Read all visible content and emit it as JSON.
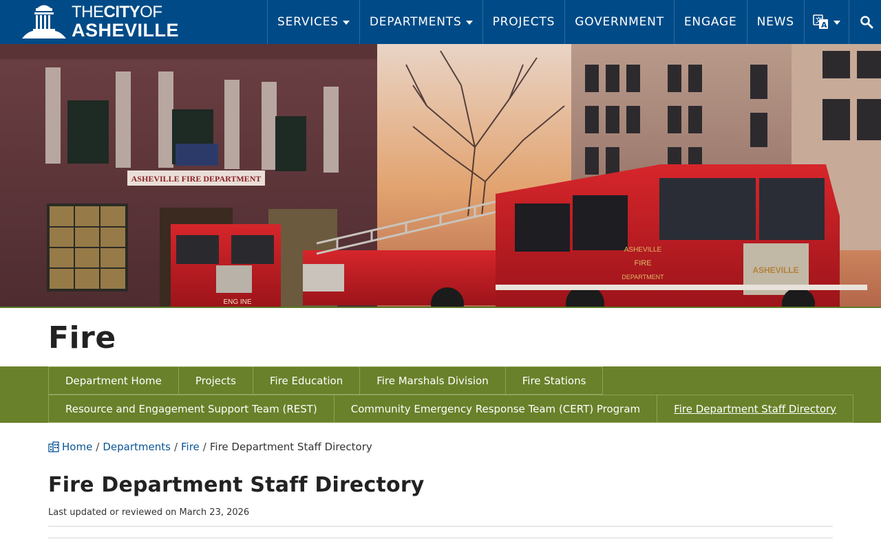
{
  "header": {
    "logo": {
      "line1_thin_a": "THE",
      "line1_bold": "CITY",
      "line1_thin_b": "OF",
      "line2": "ASHEVILLE"
    },
    "nav": [
      {
        "label": "SERVICES",
        "has_dropdown": true
      },
      {
        "label": "DEPARTMENTS",
        "has_dropdown": true
      },
      {
        "label": "PROJECTS",
        "has_dropdown": false
      },
      {
        "label": "GOVERNMENT",
        "has_dropdown": false
      },
      {
        "label": "ENGAGE",
        "has_dropdown": false
      },
      {
        "label": "NEWS",
        "has_dropdown": false
      }
    ],
    "translate_icon": "translate-icon",
    "search_icon": "search-icon",
    "bar_color": "#004b87"
  },
  "hero": {
    "building_sign": "ASHEVILLE FIRE DEPARTMENT",
    "truck_door_lines": [
      "ASHEVILLE",
      "FIRE",
      "DEPARTMENT"
    ],
    "truck_grille": "ASHEVILLE",
    "engine_label": "ENG INE"
  },
  "department": {
    "title": "Fire"
  },
  "subnav": {
    "color": "#69812a",
    "row1": [
      "Department Home",
      "Projects",
      "Fire Education",
      "Fire Marshals Division",
      "Fire Stations"
    ],
    "row2": [
      "Resource and Engagement Support Team (REST)",
      "Community Emergency Response Team (CERT) Program",
      "Fire Department Staff Directory"
    ],
    "active": "Fire Department Staff Directory"
  },
  "breadcrumb": {
    "items": [
      "Home",
      "Departments",
      "Fire"
    ],
    "current": "Fire Department Staff Directory",
    "separator": "/",
    "home_icon": "building-icon"
  },
  "page": {
    "title": "Fire Department Staff Directory",
    "updated": "Last updated or reviewed on March 23, 2026"
  }
}
